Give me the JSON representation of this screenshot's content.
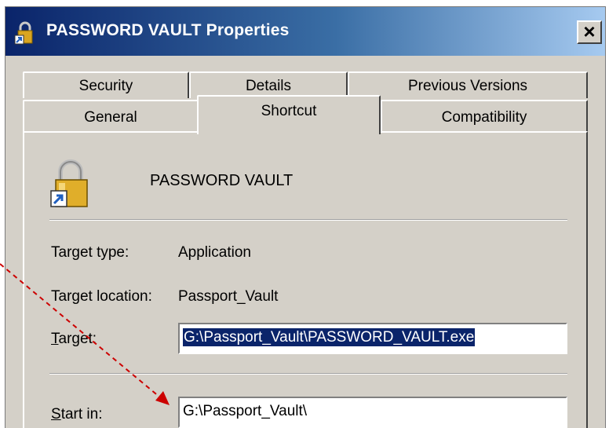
{
  "window": {
    "title": "PASSWORD VAULT Properties",
    "close_glyph": "×",
    "icon": "padlock-shortcut-icon"
  },
  "tabs": {
    "row_back": [
      {
        "label": "Security"
      },
      {
        "label": "Details"
      },
      {
        "label": "Previous Versions"
      }
    ],
    "row_front": [
      {
        "label": "General"
      },
      {
        "label": "Shortcut",
        "active": true
      },
      {
        "label": "Compatibility"
      }
    ]
  },
  "shortcut": {
    "app_name": "PASSWORD VAULT",
    "target_type_label": "Target type:",
    "target_type_value": "Application",
    "target_location_label": "Target location:",
    "target_location_value": "Passport_Vault",
    "target_label_mnemonic": "T",
    "target_label_rest": "arget:",
    "target_value": "G:\\Passport_Vault\\PASSWORD_VAULT.exe",
    "start_in_label_mnemonic": "S",
    "start_in_label_rest": "tart in:",
    "start_in_value": "G:\\Passport_Vault\\"
  },
  "annotation": {
    "arrow_color": "#cc0000"
  }
}
